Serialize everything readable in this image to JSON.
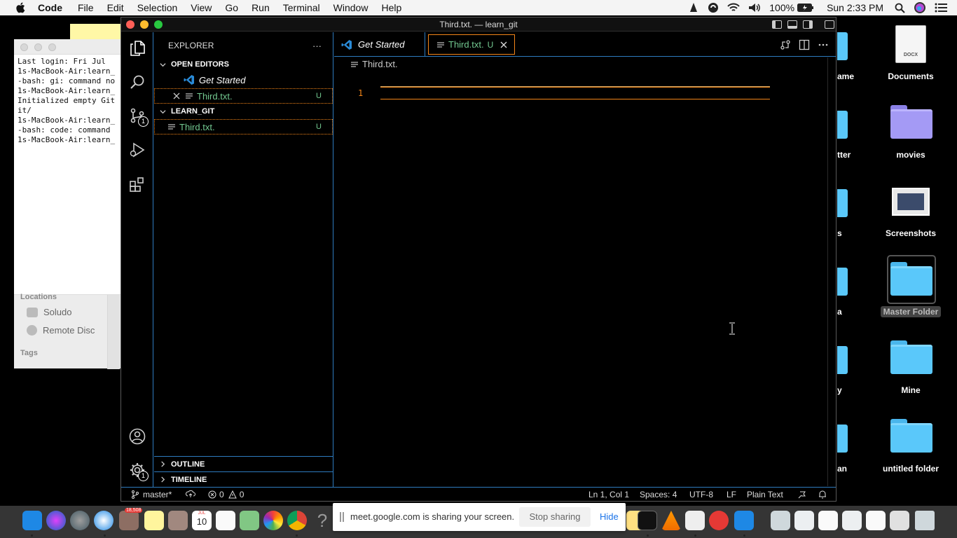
{
  "menubar": {
    "app": "Code",
    "items": [
      "File",
      "Edit",
      "Selection",
      "View",
      "Go",
      "Run",
      "Terminal",
      "Window",
      "Help"
    ],
    "battery": "100%",
    "clock": "Sun 2:33 PM"
  },
  "terminal": {
    "lines": "Last login: Fri Jul\n1s-MacBook-Air:learn_\n-bash: gi: command no\n1s-MacBook-Air:learn_\nInitialized empty Git\nit/\n1s-MacBook-Air:learn_\n-bash: code: command\n1s-MacBook-Air:learn_"
  },
  "finder": {
    "locations_label": "Locations",
    "items": [
      "Soludo",
      "Remote Disc"
    ],
    "tags_label": "Tags"
  },
  "desktop": {
    "icons": [
      "Documents",
      "movies",
      "Screenshots",
      "Master Folder",
      "Mine",
      "untitled folder"
    ],
    "docx_label": "DOCX",
    "partial_labels": [
      "ame",
      "tter",
      "s",
      "a",
      "y",
      "an"
    ]
  },
  "vscode": {
    "window_title": "Third.txt. — learn_git",
    "explorer_title": "EXPLORER",
    "explorer_more": "···",
    "open_editors_label": "OPEN EDITORS",
    "open_editors": [
      {
        "name": "Get Started",
        "badge": ""
      },
      {
        "name": "Third.txt.",
        "badge": "U"
      }
    ],
    "folder_label": "LEARN_GIT",
    "folder_files": [
      {
        "name": "Third.txt.",
        "badge": "U"
      }
    ],
    "outline_label": "OUTLINE",
    "timeline_label": "TIMELINE",
    "tabs": [
      {
        "label": "Get Started"
      },
      {
        "label": "Third.txt.",
        "badge": "U"
      }
    ],
    "breadcrumb": "Third.txt.",
    "line_number": "1",
    "scm_badge": "1",
    "settings_badge": "1",
    "status": {
      "branch": "master*",
      "errors": "0",
      "warnings": "0",
      "position": "Ln 1, Col 1",
      "spaces": "Spaces: 4",
      "encoding": "UTF-8",
      "eol": "LF",
      "language": "Plain Text"
    }
  },
  "sharebar": {
    "message": "meet.google.com is sharing your screen.",
    "stop_label": "Stop sharing",
    "hide_label": "Hide"
  },
  "dock": {
    "calendar_month": "JUL",
    "calendar_day": "10",
    "badge": "18,508"
  }
}
